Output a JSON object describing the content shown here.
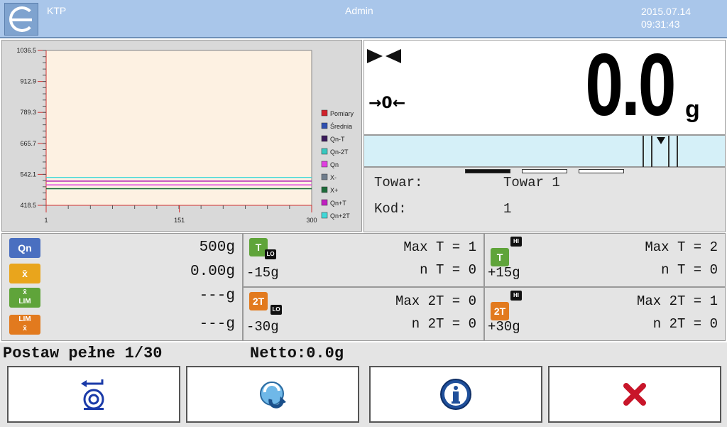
{
  "header": {
    "app_title": "KTP",
    "user": "Admin",
    "date": "2015.07.14",
    "time": "09:31:43"
  },
  "chart_data": {
    "type": "line",
    "ylabels": [
      "1036.5",
      "912.9",
      "789.3",
      "665.7",
      "542.1",
      "418.5"
    ],
    "xlabels": [
      "1",
      "151",
      "300"
    ],
    "ylim": [
      418.5,
      1036.5
    ],
    "xlim": [
      1,
      300
    ],
    "series": [
      {
        "name": "Pomiary",
        "color": "#d0202a",
        "values": []
      },
      {
        "name": "Średnia",
        "color": "#2f4fb0",
        "values": []
      },
      {
        "name": "Qn-T",
        "color": "#3a1a5a",
        "value": 500,
        "draw": false
      },
      {
        "name": "Qn-2T",
        "color": "#38c8c0",
        "value": 485
      },
      {
        "name": "Qn",
        "color": "#e040e0",
        "value": 500
      },
      {
        "name": "X-",
        "color": "#6f7d8c",
        "value": 515
      },
      {
        "name": "X+",
        "color": "#1d6b3a",
        "value": 485
      },
      {
        "name": "Qn+T",
        "color": "#c020c0",
        "value": 515
      },
      {
        "name": "Qn+2T",
        "color": "#40d8d8",
        "value": 530
      }
    ],
    "legend_position": "right"
  },
  "weight": {
    "value": "0.0",
    "unit": "g",
    "zero_indicator": "→0←"
  },
  "product": {
    "towar_label": "Towar:",
    "towar_value": "Towar 1",
    "kod_label": "Kod:",
    "kod_value": "1"
  },
  "stats": {
    "qn_icon": "Qn",
    "qn_value": "500g",
    "mean_value": "0.00g",
    "ratio1_value": "---g",
    "ratio2_value": "---g"
  },
  "tolerances": {
    "t_lo": {
      "icon": "T",
      "badge": "LO",
      "threshold": "-15g",
      "max": "Max T = 1",
      "n": "n T = 0"
    },
    "t_hi": {
      "icon": "T",
      "badge": "HI",
      "threshold": "+15g",
      "max": "Max T = 2",
      "n": "n T = 0"
    },
    "t2_lo": {
      "icon": "2T",
      "badge": "LO",
      "threshold": "-30g",
      "max": "Max 2T = 0",
      "n": "n 2T = 0"
    },
    "t2_hi": {
      "icon": "2T",
      "badge": "HI",
      "threshold": "+30g",
      "max": "Max 2T = 1",
      "n": "n 2T = 0"
    }
  },
  "status": {
    "message": "Postaw pełne 1/30",
    "netto": "Netto:0.0g"
  },
  "buttons": {
    "tare_icon": "tare-icon",
    "refresh_icon": "refresh-icon",
    "info_icon": "info-icon",
    "close_icon": "close-icon"
  }
}
